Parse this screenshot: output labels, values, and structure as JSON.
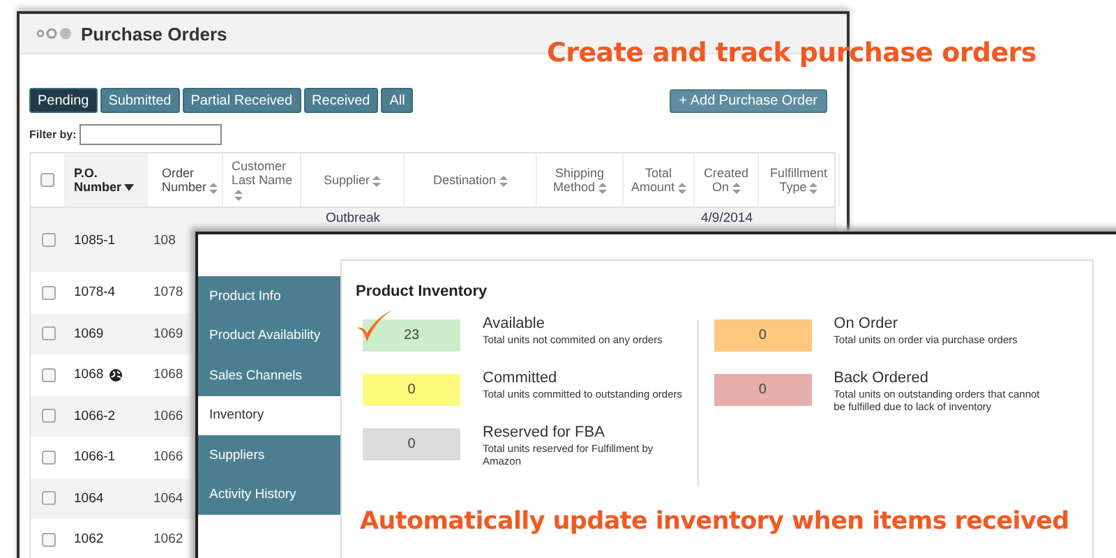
{
  "purchase_orders_window": {
    "title": "Purchase Orders",
    "tabs": [
      {
        "label": "Pending",
        "selected": true
      },
      {
        "label": "Submitted",
        "selected": false
      },
      {
        "label": "Partial Received",
        "selected": false
      },
      {
        "label": "Received",
        "selected": false
      },
      {
        "label": "All",
        "selected": false
      }
    ],
    "add_button": "+ Add Purchase Order",
    "filter": {
      "label": "Filter by:"
    },
    "table": {
      "select_all": {
        "checked": false
      },
      "columns": [
        {
          "label": "P.O. Number",
          "sorted": true
        },
        {
          "label": "Order Number",
          "sorted": false
        },
        {
          "label": "Customer Last Name",
          "sorted": false
        },
        {
          "label": "Supplier",
          "sorted": false
        },
        {
          "label": "Destination",
          "sorted": false
        },
        {
          "label": "Shipping Method",
          "sorted": false
        },
        {
          "label": "Total Amount",
          "sorted": false
        },
        {
          "label": "Created On",
          "sorted": false
        },
        {
          "label": "Fulfillment Type",
          "sorted": false
        }
      ],
      "rows": [
        {
          "checked": false,
          "po_number": "1085-1",
          "order_number": "108",
          "supplier": "Outbreak",
          "created_on": "4/9/2014",
          "globe": false
        },
        {
          "checked": false,
          "po_number": "1078-4",
          "order_number": "1078",
          "globe": false
        },
        {
          "checked": false,
          "po_number": "1069",
          "order_number": "1069",
          "globe": false
        },
        {
          "checked": false,
          "po_number": "1068",
          "order_number": "1068",
          "globe": true
        },
        {
          "checked": false,
          "po_number": "1066-2",
          "order_number": "1066",
          "globe": false
        },
        {
          "checked": false,
          "po_number": "1066-1",
          "order_number": "1066",
          "globe": false
        },
        {
          "checked": false,
          "po_number": "1064",
          "order_number": "1064",
          "globe": false
        },
        {
          "checked": false,
          "po_number": "1062",
          "order_number": "1062",
          "globe": false
        }
      ]
    }
  },
  "product_window": {
    "sidebar": [
      {
        "label": "Product Info",
        "selected": false
      },
      {
        "label": "Product Availability",
        "selected": false
      },
      {
        "label": "Sales Channels",
        "selected": false
      },
      {
        "label": "Inventory",
        "selected": true
      },
      {
        "label": "Suppliers",
        "selected": false
      },
      {
        "label": "Activity History",
        "selected": false
      }
    ],
    "heading": "Product Inventory",
    "stats": [
      {
        "value": "23",
        "label": "Available",
        "description": "Total units not commited on any orders",
        "color": "#cdeccc",
        "checkmark": true
      },
      {
        "value": "0",
        "label": "On Order",
        "description": "Total units on order via purchase orders",
        "color": "#fdc77f",
        "checkmark": false
      },
      {
        "value": "0",
        "label": "Committed",
        "description": "Total units committed to outstanding orders",
        "color": "#fbfb7c",
        "checkmark": false
      },
      {
        "value": "0",
        "label": "Back Ordered",
        "description": "Total units on outstanding orders that cannot be fulfilled due to lack of inventory",
        "color": "#e6adad",
        "checkmark": false
      },
      {
        "value": "0",
        "label": "Reserved for FBA",
        "description": "Total units reserved for Fulfillment by Amazon",
        "color": "#dcdcdc",
        "checkmark": false
      }
    ]
  },
  "captions": [
    "Create and track purchase orders",
    "Automatically update inventory when items received"
  ]
}
